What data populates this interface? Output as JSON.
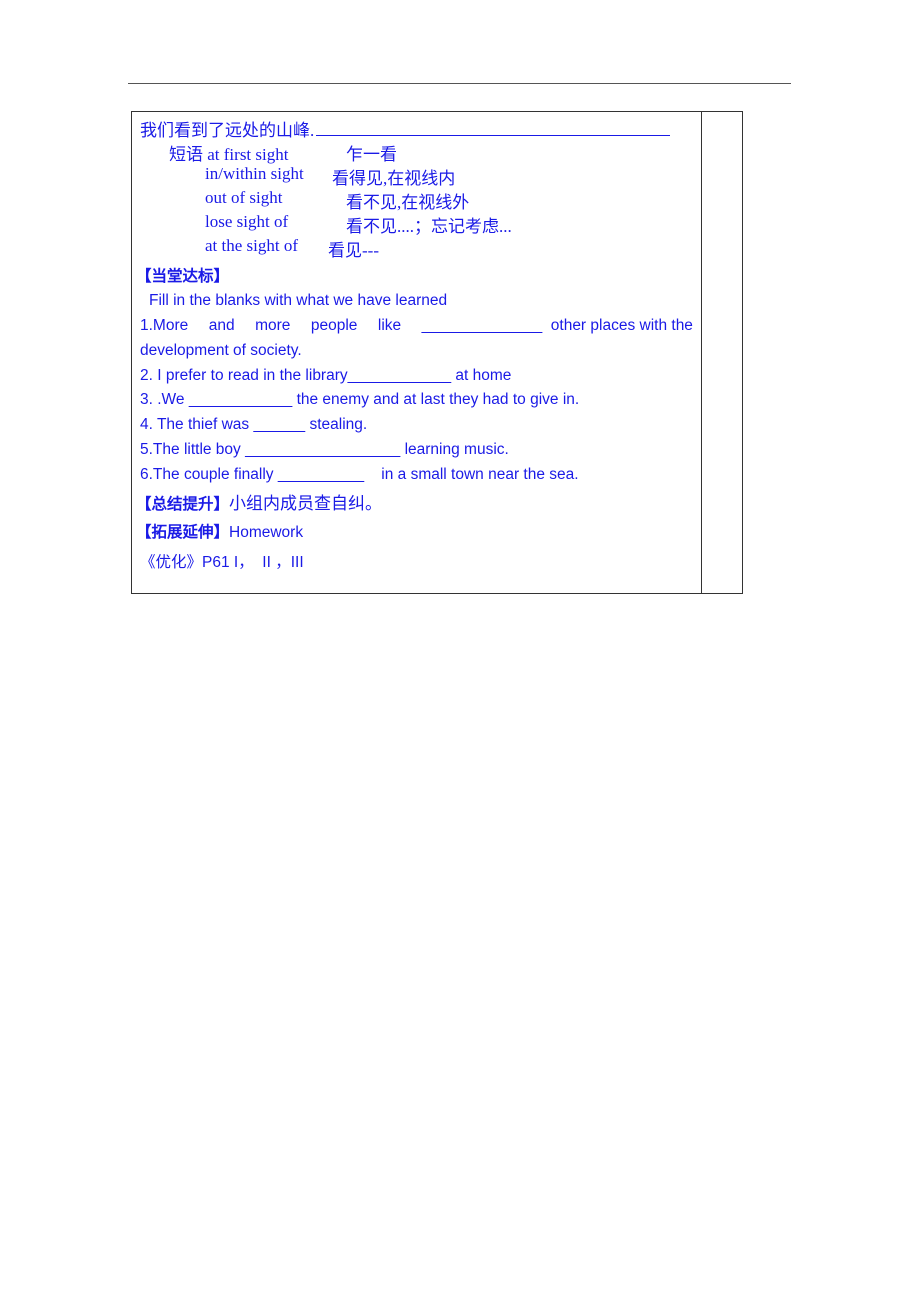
{
  "document": {
    "translation_line": {
      "text": "我们看到了远处的山峰.",
      "blank": ""
    },
    "phrases": {
      "label": "短语",
      "items": [
        {
          "en": "at first sight",
          "zh": "乍一看"
        },
        {
          "en": "in/within sight",
          "zh": "看得见,在视线内"
        },
        {
          "en": "out of sight",
          "zh": "看不见,在视线外"
        },
        {
          "en": "lose sight of",
          "zh": "看不见....；忘记考虑..."
        },
        {
          "en": "at the sight of",
          "zh": "看见---"
        }
      ]
    },
    "section_practice": {
      "heading": "【当堂达标】",
      "instruction": "Fill in the blanks with what we have learned",
      "q1_part1": "1.More",
      "q1_words": [
        "and",
        "more",
        "people",
        "like"
      ],
      "q1_blank": "______________",
      "q1_rest": "other places with the",
      "q1_line2": "development of society.",
      "q2": "2. I prefer to read in the library____________ at home",
      "q3": "3. .We ____________ the enemy and at last they had to give in.",
      "q4": "4. The thief was ______ stealing.",
      "q5": "5.The little boy __________________ learning music.",
      "q6": "6.The couple finally __________    in a small town near the sea."
    },
    "section_summary": {
      "heading": "【总结提升】",
      "text": "小组内成员查自纠。"
    },
    "section_extension": {
      "heading": "【拓展延伸】",
      "text": "Homework",
      "reference": "《优化》P61 I，  II ，III"
    }
  }
}
